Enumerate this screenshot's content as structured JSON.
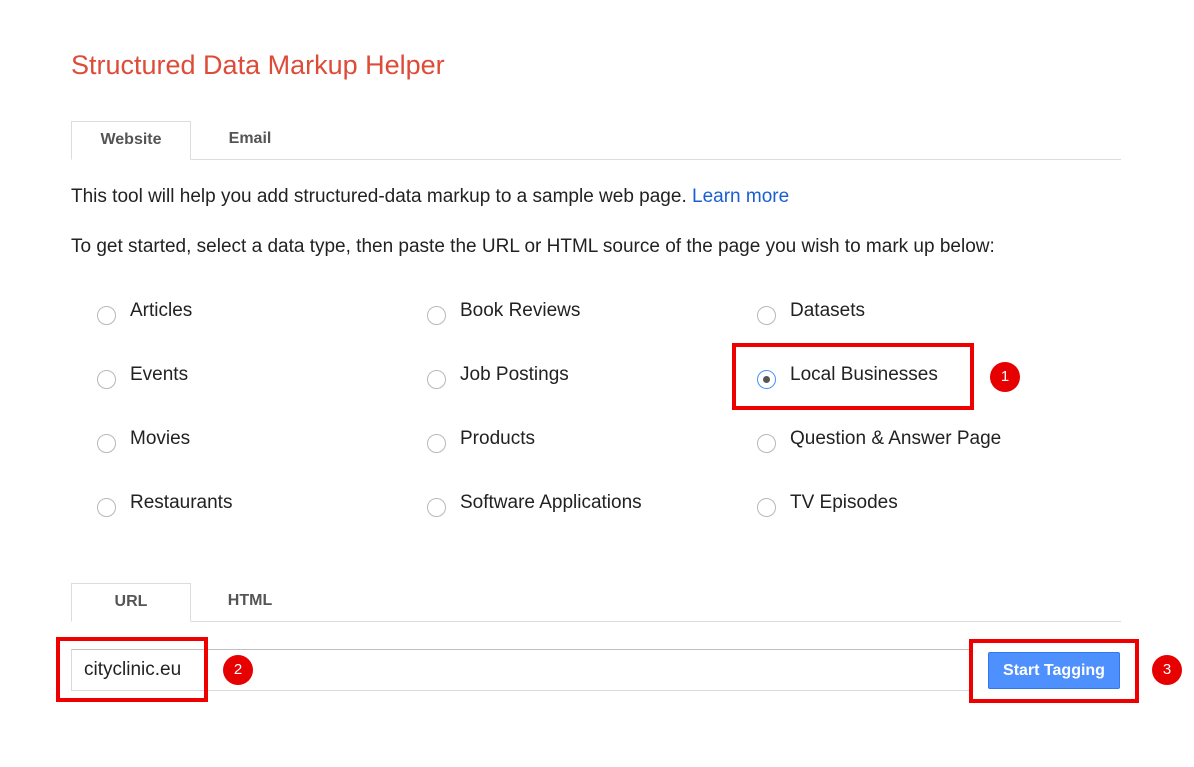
{
  "page_title": "Structured Data Markup Helper",
  "source_tabs": [
    {
      "label": "Website",
      "active": true
    },
    {
      "label": "Email",
      "active": false
    }
  ],
  "intro": {
    "text": "This tool will help you add structured-data markup to a sample web page. ",
    "link_label": "Learn more"
  },
  "instruction": "To get started, select a data type, then paste the URL or HTML source of the page you wish to mark up below:",
  "data_types": {
    "selected": "Local Businesses",
    "options": [
      "Articles",
      "Book Reviews",
      "Datasets",
      "Events",
      "Job Postings",
      "Local Businesses",
      "Movies",
      "Products",
      "Question & Answer Page",
      "Restaurants",
      "Software Applications",
      "TV Episodes"
    ]
  },
  "input_tabs": [
    {
      "label": "URL",
      "active": true
    },
    {
      "label": "HTML",
      "active": false
    }
  ],
  "url_input": {
    "value": "cityclinic.eu",
    "placeholder": ""
  },
  "start_button_label": "Start Tagging",
  "annotations": {
    "step1": "1",
    "step2": "2",
    "step3": "3",
    "color": "#ee0000"
  },
  "colors": {
    "title": "#dd4b39",
    "link": "#1a5fd0",
    "button": "#4d90fe"
  }
}
